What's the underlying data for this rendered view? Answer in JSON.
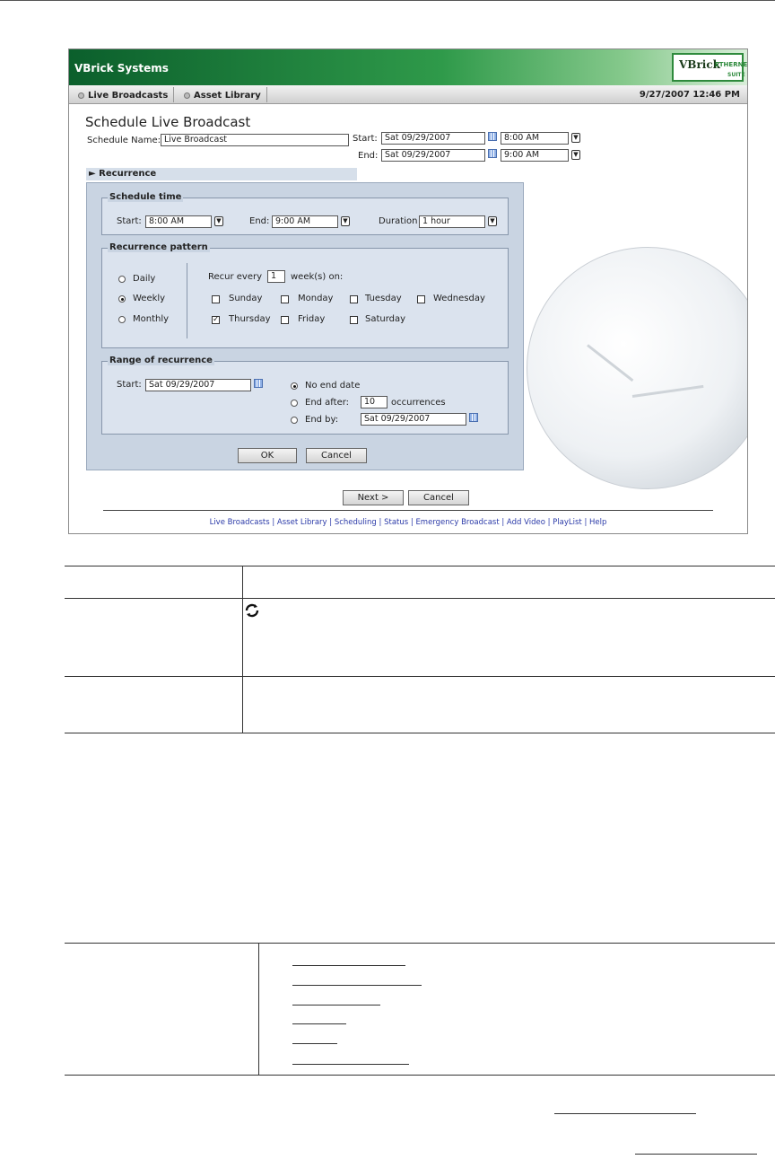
{
  "app": {
    "brand": "VBrick Systems",
    "logo": {
      "main": "VBrick",
      "sub": "ETHERNETV",
      "suite": "SUITE"
    },
    "nav_tabs": [
      "Live Broadcasts",
      "Asset Library"
    ],
    "datetime": "9/27/2007 12:46 PM"
  },
  "page": {
    "title": "Schedule Live Broadcast",
    "schedule_name_label": "Schedule Name:",
    "schedule_name_value": "Live Broadcast",
    "start_label": "Start:",
    "start_date": "Sat 09/29/2007",
    "start_time": "8:00 AM",
    "end_label": "End:",
    "end_date": "Sat 09/29/2007",
    "end_time": "9:00 AM",
    "recurrence_toggle": "► Recurrence"
  },
  "recurrence": {
    "schedule_time": {
      "legend": "Schedule time",
      "start_label": "Start:",
      "start_value": "8:00 AM",
      "end_label": "End:",
      "end_value": "9:00 AM",
      "duration_label": "Duration",
      "duration_value": "1 hour"
    },
    "pattern": {
      "legend": "Recurrence pattern",
      "options": [
        "Daily",
        "Weekly",
        "Monthly"
      ],
      "selected": "Weekly",
      "recur_every_label": "Recur every",
      "recur_every_value": "1",
      "weeks_on_label": "week(s) on:",
      "days": [
        {
          "label": "Sunday",
          "checked": false
        },
        {
          "label": "Monday",
          "checked": false
        },
        {
          "label": "Tuesday",
          "checked": false
        },
        {
          "label": "Wednesday",
          "checked": false
        },
        {
          "label": "Thursday",
          "checked": true
        },
        {
          "label": "Friday",
          "checked": false
        },
        {
          "label": "Saturday",
          "checked": false
        }
      ]
    },
    "range": {
      "legend": "Range of recurrence",
      "start_label": "Start:",
      "start_value": "Sat 09/29/2007",
      "no_end_label": "No end date",
      "end_after_label": "End after:",
      "end_after_value": "10",
      "occurrences_label": "occurrences",
      "end_by_label": "End by:",
      "end_by_value": "Sat 09/29/2007",
      "selected": "No end date"
    },
    "ok_label": "OK",
    "cancel_label": "Cancel"
  },
  "footer": {
    "next_label": "Next >",
    "cancel_label": "Cancel",
    "links": "Live Broadcasts | Asset Library | Scheduling | Status | Emergency Broadcast | Add Video | PlayList | Help"
  },
  "doc": {
    "sync_icon": "refresh-icon"
  }
}
